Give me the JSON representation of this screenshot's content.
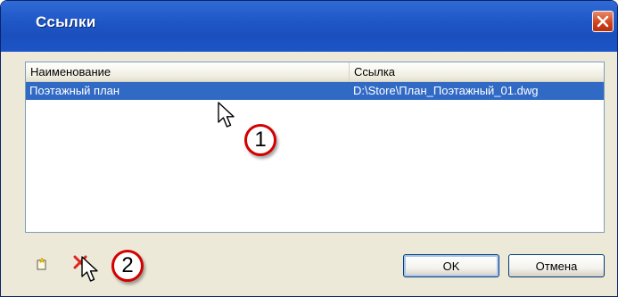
{
  "window": {
    "title": "Ссылки",
    "close_icon": "close-icon"
  },
  "list": {
    "columns": [
      "Наименование",
      "Ссылка"
    ],
    "rows": [
      {
        "name": "Поэтажный план",
        "link": "D:\\Store\\План_Поэтажный_01.dwg",
        "selected": true
      }
    ]
  },
  "toolbar": {
    "new_icon": "new-item-icon",
    "delete_icon": "delete-x-icon"
  },
  "buttons": {
    "ok": "OK",
    "cancel": "Отмена"
  },
  "annotations": {
    "callout_1": "1",
    "callout_2": "2"
  },
  "colors": {
    "titlebar": "#1f57c6",
    "selection": "#316ac5",
    "callout_border": "#d40000",
    "dialog_bg": "#ece9d8"
  }
}
